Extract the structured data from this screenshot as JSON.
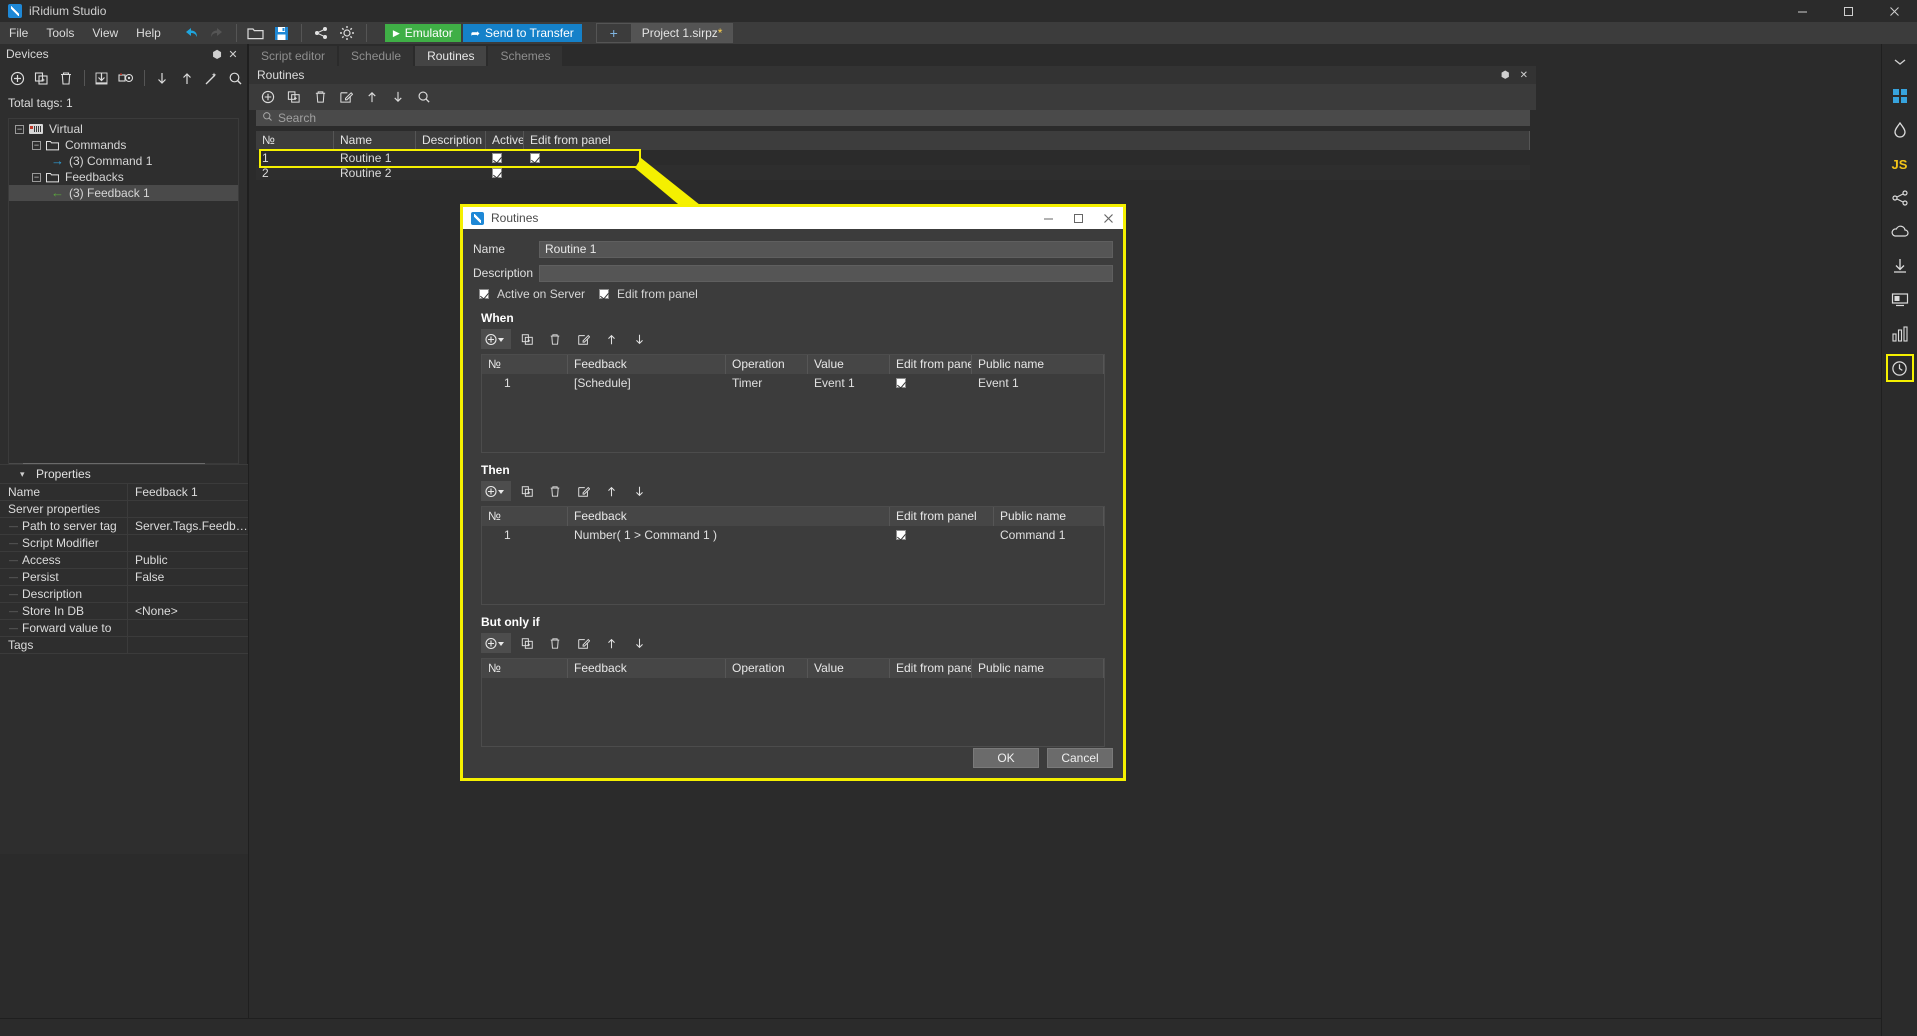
{
  "window": {
    "title": "iRidium Studio",
    "minimize": "minimize-icon",
    "maximize": "maximize-icon",
    "close": "close-icon"
  },
  "menubar": {
    "items": [
      "File",
      "Tools",
      "View",
      "Help"
    ],
    "icons": [
      "undo-icon",
      "redo-icon",
      "open-folder-icon",
      "save-icon",
      "share-icon",
      "gear-icon"
    ]
  },
  "toolbar": {
    "emulator_label": "Emulator",
    "transfer_label": "Send to Transfer",
    "add_tab_label": "+",
    "project_tab": "Project 1.sirpz",
    "project_modified_marker": "*"
  },
  "devices": {
    "title": "Devices",
    "pin_icon": "pin-icon",
    "close_icon": "close-icon",
    "toolbar_icons": [
      "add-device-icon",
      "copy-device-icon",
      "delete-device-icon",
      "import-icon",
      "camera-icon",
      "move-down-icon",
      "move-up-icon",
      "wand-icon",
      "search-icon"
    ],
    "total_tags_label": "Total tags: 1",
    "tree": [
      {
        "label": "Virtual",
        "icon": "device-icon",
        "depth": 0,
        "expander": "-",
        "selected": false
      },
      {
        "label": "Commands",
        "icon": "folder-icon",
        "depth": 1,
        "expander": "-",
        "selected": false
      },
      {
        "label": "(3) Command 1",
        "icon": "arrow-right-icon",
        "depth": 2,
        "expander": "",
        "selected": false
      },
      {
        "label": "Feedbacks",
        "icon": "folder-icon",
        "depth": 1,
        "expander": "-",
        "selected": false
      },
      {
        "label": "(3) Feedback 1",
        "icon": "arrow-left-icon",
        "depth": 2,
        "expander": "",
        "selected": true
      }
    ]
  },
  "properties": {
    "title": "Properties",
    "rows": [
      {
        "key": "Name",
        "value": "Feedback 1",
        "sub": false
      },
      {
        "key": "Server properties",
        "value": "",
        "sub": false
      },
      {
        "key": "Path to server tag",
        "value": "Server.Tags.Feedba...",
        "sub": true
      },
      {
        "key": "Script Modifier",
        "value": "",
        "sub": true
      },
      {
        "key": "Access",
        "value": "Public",
        "sub": true
      },
      {
        "key": "Persist",
        "value": "False",
        "sub": true
      },
      {
        "key": "Description",
        "value": "",
        "sub": true
      },
      {
        "key": "Store In DB",
        "value": "<None>",
        "sub": true
      },
      {
        "key": "Forward value to",
        "value": "",
        "sub": true
      },
      {
        "key": "Tags",
        "value": "",
        "sub": false
      }
    ]
  },
  "main": {
    "tabs": [
      {
        "label": "Script editor",
        "active": false
      },
      {
        "label": "Schedule",
        "active": false
      },
      {
        "label": "Routines",
        "active": true
      },
      {
        "label": "Schemes",
        "active": false
      }
    ],
    "subheader_title": "Routines",
    "subheader_pin_icon": "pin-icon",
    "subheader_close_icon": "close-icon",
    "toolbar_icons": [
      "add-routine-icon",
      "copy-routine-icon",
      "delete-routine-icon",
      "edit-routine-icon",
      "move-up-icon",
      "move-down-icon",
      "search-icon"
    ],
    "search_placeholder": "Search",
    "search_value": "",
    "table": {
      "columns": [
        "№",
        "Name",
        "Description",
        "Active",
        "Edit from panel"
      ],
      "rows": [
        {
          "no": "1",
          "name": "Routine 1",
          "description": "",
          "active": true,
          "edit_from_panel": true
        },
        {
          "no": "2",
          "name": "Routine 2",
          "description": "",
          "active": true,
          "edit_from_panel": false
        }
      ]
    }
  },
  "right_sidebar": {
    "items": [
      {
        "icon": "chevron-down-icon",
        "name": "collapse-icon",
        "highlighted": false
      },
      {
        "icon": "grid-icon",
        "name": "project-icon",
        "highlighted": false
      },
      {
        "icon": "drop-icon",
        "name": "devices-icon",
        "highlighted": false
      },
      {
        "icon": "js-icon",
        "name": "script-icon",
        "label": "JS",
        "highlighted": false
      },
      {
        "icon": "node-icon",
        "name": "schemes-icon",
        "highlighted": false
      },
      {
        "icon": "cloud-icon",
        "name": "cloud-icon",
        "highlighted": false
      },
      {
        "icon": "download-icon",
        "name": "download-icon",
        "highlighted": false
      },
      {
        "icon": "panel-icon",
        "name": "panel-icon",
        "highlighted": false
      },
      {
        "icon": "chart-icon",
        "name": "stats-icon",
        "highlighted": false
      },
      {
        "icon": "clock-icon",
        "name": "routines-icon",
        "highlighted": true
      }
    ]
  },
  "modal": {
    "title": "Routines",
    "icon": "app-icon",
    "minimize": "minimize-icon",
    "maximize": "maximize-icon",
    "close": "close-icon",
    "name_label": "Name",
    "name_value": "Routine 1",
    "description_label": "Description",
    "description_value": "",
    "active_on_server_label": "Active on Server",
    "active_on_server_checked": true,
    "edit_from_panel_label": "Edit from panel",
    "edit_from_panel_checked": true,
    "sections": [
      {
        "title": "When",
        "toolbar_icons": [
          "add-dropdown-icon",
          "copy-icon",
          "delete-icon",
          "edit-icon",
          "move-up-icon",
          "move-down-icon"
        ],
        "columns": [
          "№",
          "Feedback",
          "Operation",
          "Value",
          "Edit from panel",
          "Public name"
        ],
        "rows": [
          {
            "no": "1",
            "feedback": "[Schedule]",
            "operation": "Timer",
            "value": "Event 1",
            "edit_from_panel": true,
            "public_name": "Event 1"
          }
        ]
      },
      {
        "title": "Then",
        "toolbar_icons": [
          "add-dropdown-icon",
          "copy-icon",
          "delete-icon",
          "edit-icon",
          "move-up-icon",
          "move-down-icon"
        ],
        "columns": [
          "№",
          "Feedback",
          "Edit from panel",
          "Public name"
        ],
        "rows": [
          {
            "no": "1",
            "feedback": "Number( 1 > Command 1 )",
            "edit_from_panel": true,
            "public_name": "Command 1"
          }
        ]
      },
      {
        "title": "But only if",
        "toolbar_icons": [
          "add-dropdown-icon",
          "copy-icon",
          "delete-icon",
          "edit-icon",
          "move-up-icon",
          "move-down-icon"
        ],
        "columns": [
          "№",
          "Feedback",
          "Operation",
          "Value",
          "Edit from panel",
          "Public name"
        ],
        "rows": []
      }
    ],
    "ok_label": "OK",
    "cancel_label": "Cancel"
  },
  "colors": {
    "highlight": "#f5f000",
    "accent_blue": "#1581c9",
    "accent_green": "#3faf46",
    "background": "#2b2b2b",
    "panel": "#3c3c3c"
  }
}
